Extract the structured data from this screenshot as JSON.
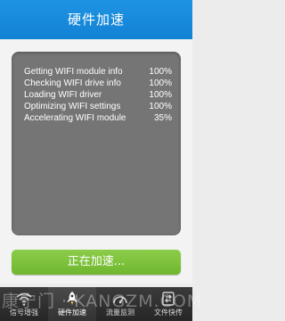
{
  "header": {
    "title": "硬件加速"
  },
  "log": {
    "rows": [
      {
        "message": "Getting WIFI module info",
        "percent": "100%"
      },
      {
        "message": "Checking WIFI drive info",
        "percent": "100%"
      },
      {
        "message": "Loading WIFI driver",
        "percent": "100%"
      },
      {
        "message": "Optimizing WIFI settings",
        "percent": "100%"
      },
      {
        "message": "Accelerating WIFI module",
        "percent": "35%"
      }
    ]
  },
  "action": {
    "button_label": "正在加速..."
  },
  "tabbar": {
    "tabs": [
      {
        "label": "信号增强",
        "icon": "wifi-icon"
      },
      {
        "label": "硬件加速",
        "icon": "rocket-icon",
        "active": true
      },
      {
        "label": "流量监测",
        "icon": "gauge-icon"
      },
      {
        "label": "文件快传",
        "icon": "transfer-icon"
      }
    ]
  },
  "watermark": {
    "text": "康宁门 · KANGZM.COM"
  },
  "colors": {
    "header": "#1a8cdc",
    "button": "#7cc13c",
    "panel": "#757575",
    "tabbar": "#2f2f2f"
  }
}
